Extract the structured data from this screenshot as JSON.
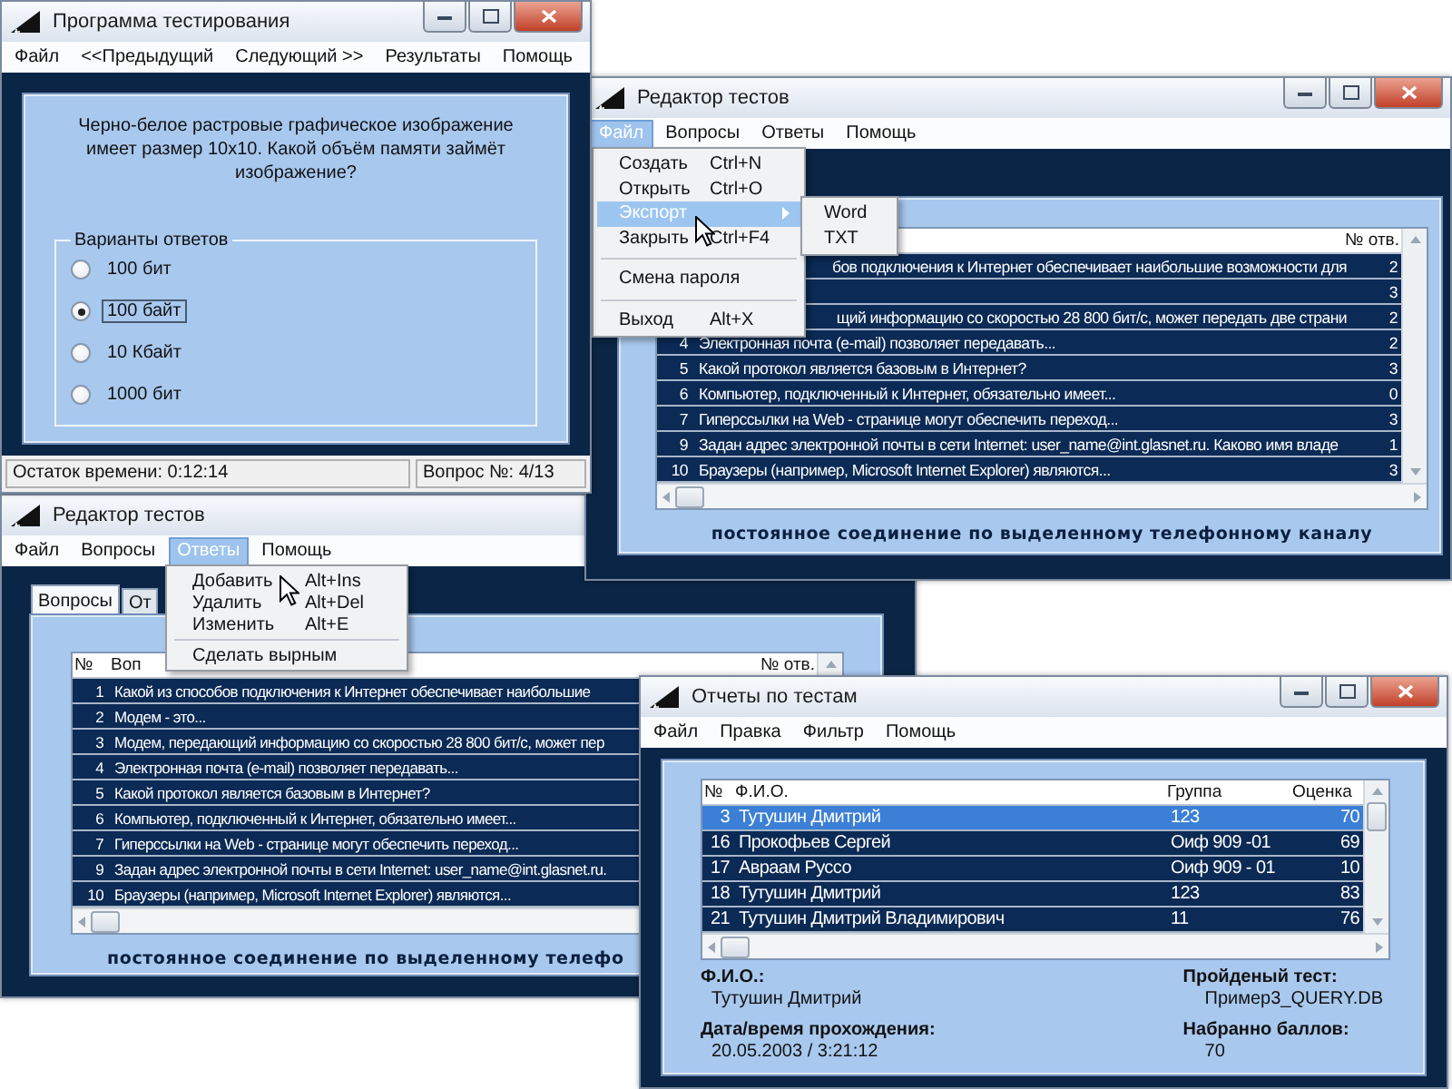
{
  "testing_window": {
    "title": "Программа тестирования",
    "menu": [
      {
        "label": "Файл",
        "selected": false
      },
      {
        "label": "<<Предыдущий",
        "selected": false
      },
      {
        "label": "Следующий >>",
        "selected": false
      },
      {
        "label": "Результаты",
        "selected": false
      },
      {
        "label": "Помощь",
        "selected": false
      }
    ],
    "question": "Черно-белое растровые графическое изображение имеет размер 10x10. Какой объём памяти займёт изображение?",
    "answers_group": {
      "legend": "Варианты ответов",
      "options": [
        {
          "label": "100 бит",
          "selected": false
        },
        {
          "label": "100 байт",
          "selected": true
        },
        {
          "label": "10 Кбайт",
          "selected": false
        },
        {
          "label": "1000 бит",
          "selected": false
        }
      ]
    },
    "status_bar": {
      "time_left": "Остаток времени: 0:12:14",
      "question_counter": "Вопрос №: 4/13"
    }
  },
  "editor_top": {
    "title": "Редактор тестов",
    "menu": [
      {
        "label": "Файл",
        "selected": true
      },
      {
        "label": "Вопросы",
        "selected": false
      },
      {
        "label": "Ответы",
        "selected": false
      },
      {
        "label": "Помощь",
        "selected": false
      }
    ],
    "dropdown": [
      {
        "kind": "item",
        "label": "Создать",
        "shortcut": "Ctrl+N",
        "selected": false
      },
      {
        "kind": "item",
        "label": "Открыть",
        "shortcut": "Ctrl+O",
        "selected": false
      },
      {
        "kind": "submenu",
        "label": "Экспорт",
        "selected": true,
        "children": [
          {
            "label": "Word"
          },
          {
            "label": "TXT"
          }
        ]
      },
      {
        "kind": "item",
        "label": "Закрыть",
        "shortcut": "Ctrl+F4",
        "selected": false
      },
      {
        "kind": "separator"
      },
      {
        "kind": "item",
        "label": "Смена пароля",
        "selected": false
      },
      {
        "kind": "separator"
      },
      {
        "kind": "item",
        "label": "Выход",
        "shortcut": "Alt+X",
        "selected": false
      }
    ],
    "table": {
      "header": {
        "answers": "№ отв."
      },
      "rows": [
        {
          "text": "бов подключения к Интернет обеспечивает наибольшие возможности для",
          "answers": "2",
          "text_start_hidden": true
        },
        {
          "answers": "3"
        },
        {
          "text": "щий информацию со скоростью 28 800 бит/с, может передать две страни",
          "answers": "2",
          "text_start_hidden": true
        },
        {
          "number": "4",
          "text": "Электронная почта (e-mail) позволяет передавать...",
          "answers": "2"
        },
        {
          "number": "5",
          "text": "Какой протокол является базовым в Интернет?",
          "answers": "3"
        },
        {
          "number": "6",
          "text": "Компьютер, подключенный к Интернет, обязательно имеет...",
          "answers": "0"
        },
        {
          "number": "7",
          "text": "Гиперссылки на Web - странице могут обеспечить переход...",
          "answers": "3"
        },
        {
          "number": "9",
          "text": "Задан адрес электронной почты в сети Internet: user_name@int.glasnet.ru. Каково имя владе",
          "answers": "1"
        },
        {
          "number": "10",
          "text": "Браузеры (например, Microsoft Internet Explorer) являются...",
          "answers": "3"
        }
      ]
    },
    "caption": "постоянное соединение по выделенному телефонному каналу"
  },
  "editor_bottom": {
    "title": "Редактор тестов",
    "menu": [
      {
        "label": "Файл",
        "selected": false
      },
      {
        "label": "Вопросы",
        "selected": false
      },
      {
        "label": "Ответы",
        "selected": true
      },
      {
        "label": "Помощь",
        "selected": false
      }
    ],
    "tabs": [
      {
        "label": "Вопросы",
        "selected": true
      },
      {
        "label": "От",
        "selected": false
      }
    ],
    "dropdown": [
      {
        "kind": "item",
        "label": "Добавить",
        "shortcut": "Alt+Ins",
        "selected": false
      },
      {
        "kind": "item",
        "label": "Удалить",
        "shortcut": "Alt+Del",
        "selected": false
      },
      {
        "kind": "item",
        "label": "Изменить",
        "shortcut": "Alt+E",
        "selected": false
      },
      {
        "kind": "separator"
      },
      {
        "kind": "item",
        "label": "Сделать вырным",
        "selected": false
      }
    ],
    "table": {
      "header": {
        "number": "№",
        "question": "Воп",
        "answers": "№ отв."
      },
      "rows": [
        {
          "number": "1",
          "text": "Какой из способов подключения к Интернет обеспечивает наибольшие"
        },
        {
          "number": "2",
          "text": "Модем - это..."
        },
        {
          "number": "3",
          "text": "Модем, передающий информацию со скоростью 28 800 бит/с, может пер"
        },
        {
          "number": "4",
          "text": "Электронная почта (e-mail) позволяет передавать..."
        },
        {
          "number": "5",
          "text": "Какой протокол является базовым в Интернет?"
        },
        {
          "number": "6",
          "text": "Компьютер, подключенный к Интернет, обязательно имеет..."
        },
        {
          "number": "7",
          "text": "Гиперссылки на Web - странице могут обеспечить переход..."
        },
        {
          "number": "9",
          "text": "Задан адрес электронной почты в сети Internet: user_name@int.glasnet.ru."
        },
        {
          "number": "10",
          "text": "Браузеры (например, Microsoft Internet Explorer) являются..."
        }
      ]
    },
    "caption": "постоянное соединение по выделенному телефо"
  },
  "reports_window": {
    "title": "Отчеты по тестам",
    "menu": [
      {
        "label": "Файл",
        "selected": false
      },
      {
        "label": "Правка",
        "selected": false
      },
      {
        "label": "Фильтр",
        "selected": false
      },
      {
        "label": "Помощь",
        "selected": false
      }
    ],
    "table": {
      "columns": [
        "№",
        "Ф.И.О.",
        "Группа",
        "Оценка"
      ],
      "rows": [
        {
          "cells": [
            "3",
            "Тутушин Дмитрий",
            "123",
            "70"
          ],
          "selected": true
        },
        {
          "cells": [
            "16",
            "Прокофьев Сергей",
            "Оиф 909 -01",
            "69"
          ],
          "selected": false
        },
        {
          "cells": [
            "17",
            "Авраам Руссо",
            "Оиф 909 - 01",
            "10"
          ],
          "selected": false
        },
        {
          "cells": [
            "18",
            "Тутушин Дмитрий",
            "123",
            "83"
          ],
          "selected": false
        },
        {
          "cells": [
            "21",
            "Тутушин Дмитрий Владимирович",
            "11",
            "76"
          ],
          "selected": false
        }
      ]
    },
    "details": {
      "name_label": "Ф.И.О.:",
      "name": "Тутушин Дмитрий",
      "date_label": "Дата/время прохождения:",
      "date": "20.05.2003 / 3:21:12",
      "test_label": "Пройденый тест:",
      "test": "Пример3_QUERY.DB",
      "score_label": "Набранно баллов:",
      "score": "70"
    }
  }
}
